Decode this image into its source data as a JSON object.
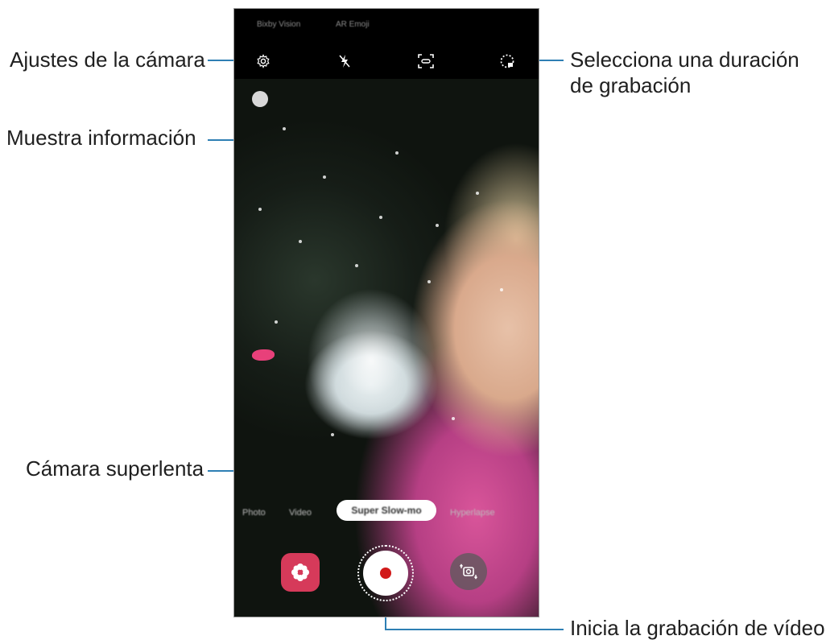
{
  "callouts": {
    "settings": "Ajustes de la cámara",
    "info": "Muestra información",
    "duration": "Selecciona una duración de grabación",
    "super_slow": "Cámara superlenta",
    "record": "Inicia la grabación de vídeo"
  },
  "camera": {
    "top_modes": [
      "Bixby Vision",
      "AR Emoji"
    ],
    "toolbar_icons": [
      "gear-icon",
      "flash-off-icon",
      "motion-detect-icon",
      "duration-icon"
    ],
    "mode_row": {
      "left_modes": [
        "Photo",
        "Video"
      ],
      "selected_mode": "Super Slow-mo",
      "right_mode": "Hyperlapse"
    },
    "bottom_controls": [
      "gallery-flower-icon",
      "record-button",
      "switch-camera-icon"
    ]
  },
  "colors": {
    "leader": "#2e7fb4",
    "record": "#d11a1a",
    "gallery": "#d63a5a"
  }
}
